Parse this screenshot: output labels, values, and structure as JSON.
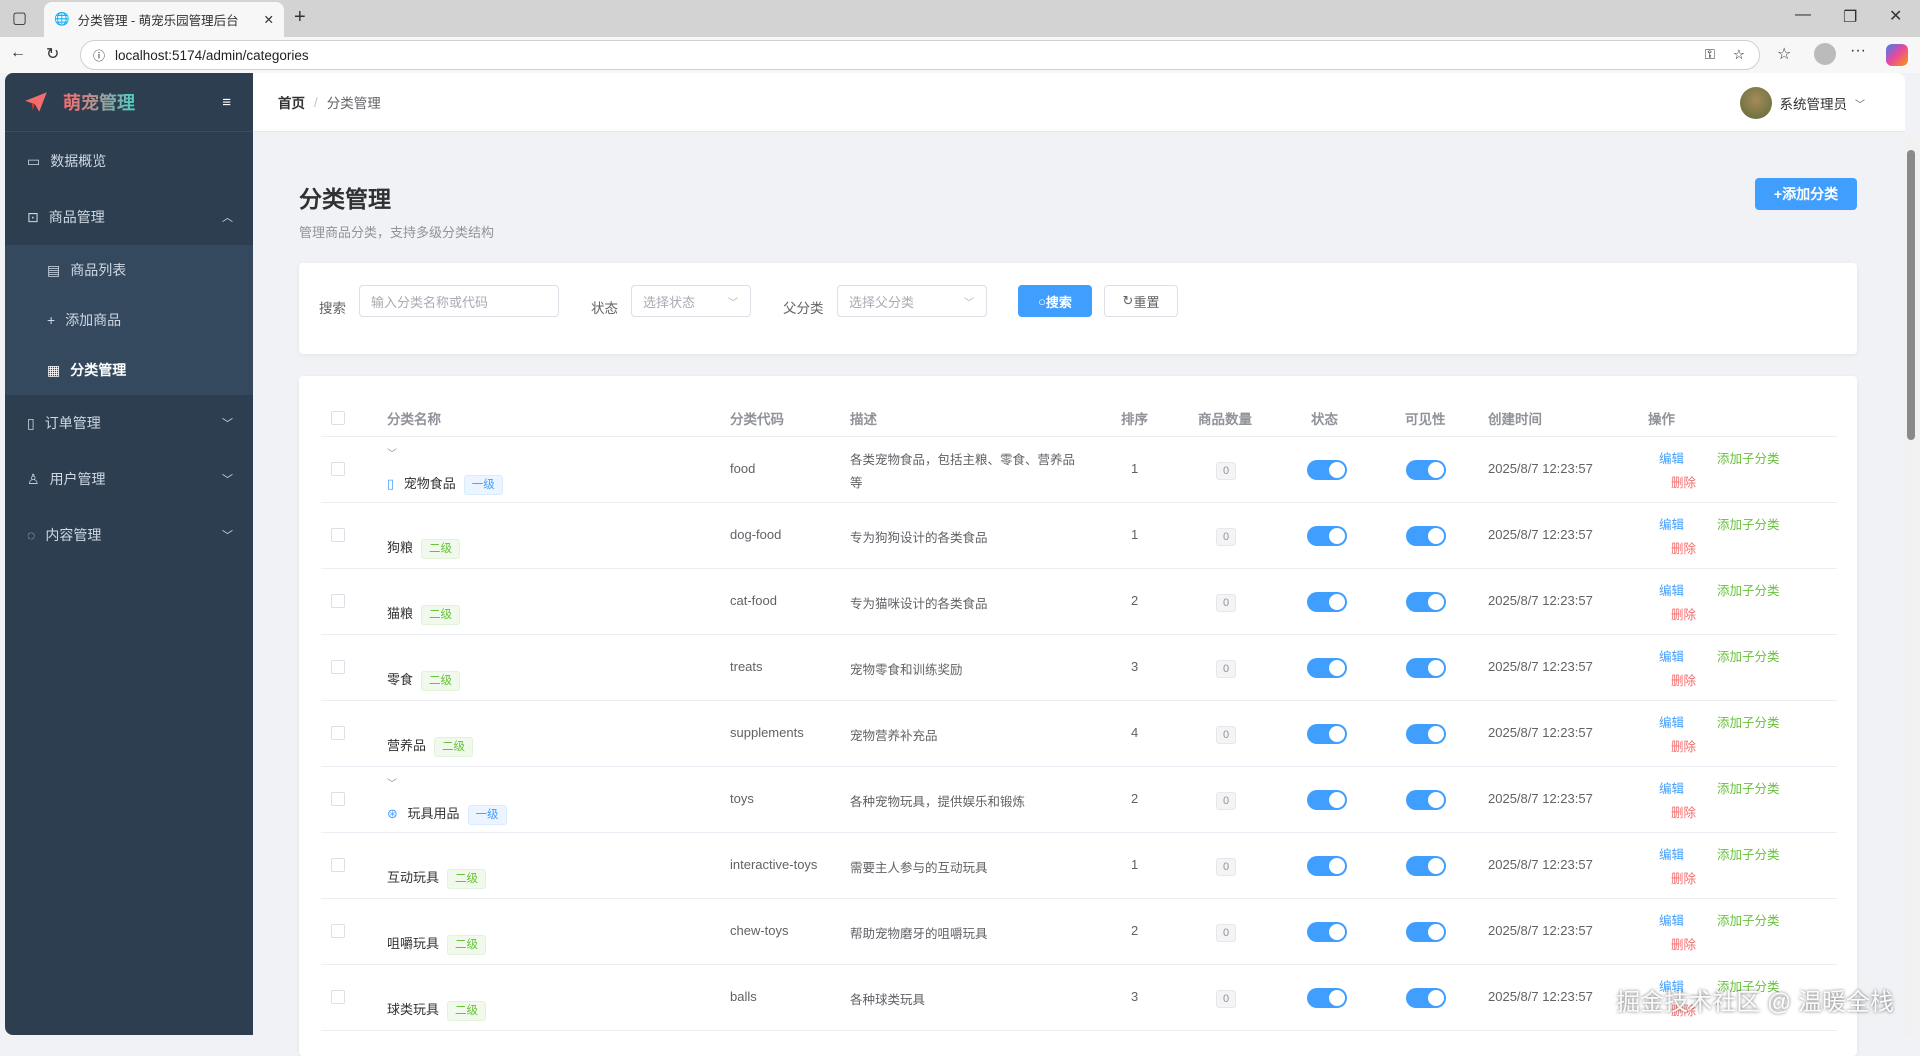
{
  "browser": {
    "tab_title": "分类管理 - 萌宠乐园管理后台",
    "url": "localhost:5174/admin/categories"
  },
  "sidebar": {
    "brand": "萌宠管理",
    "items": [
      {
        "label": "数据概览",
        "icon": "chart-icon"
      },
      {
        "label": "商品管理",
        "icon": "bag-icon",
        "expanded": true
      },
      {
        "label": "商品列表",
        "icon": "list-icon"
      },
      {
        "label": "添加商品",
        "icon": "plus-icon"
      },
      {
        "label": "分类管理",
        "icon": "grid-icon",
        "active": true
      },
      {
        "label": "订单管理",
        "icon": "document-icon"
      },
      {
        "label": "用户管理",
        "icon": "user-icon"
      },
      {
        "label": "内容管理",
        "icon": "chat-icon"
      }
    ]
  },
  "header": {
    "breadcrumb_home": "首页",
    "breadcrumb_sep": "/",
    "breadcrumb_current": "分类管理",
    "user": "系统管理员"
  },
  "page": {
    "title": "分类管理",
    "subtitle": "管理商品分类，支持多级分类结构",
    "add_button": "+添加分类"
  },
  "filter": {
    "search_label": "搜索",
    "search_placeholder": "输入分类名称或代码",
    "status_label": "状态",
    "status_placeholder": "选择状态",
    "parent_label": "父分类",
    "parent_placeholder": "选择父分类",
    "search_button": "搜索",
    "reset_button": "重置"
  },
  "table": {
    "columns": [
      "分类名称",
      "分类代码",
      "描述",
      "排序",
      "商品数量",
      "状态",
      "可见性",
      "创建时间",
      "操作"
    ],
    "actions": {
      "edit": "编辑",
      "add_child": "添加子分类",
      "delete": "删除"
    },
    "rows": [
      {
        "name": "宠物食品",
        "level": "一级",
        "code": "food",
        "desc": "各类宠物食品，包括主粮、零食、营养品",
        "desc2": "等",
        "sort": "1",
        "count": "0",
        "status": true,
        "visible": true,
        "created": "2025/8/7 12:23:57",
        "parent": true,
        "icon": "cup-icon"
      },
      {
        "name": "狗粮",
        "level": "二级",
        "code": "dog-food",
        "desc": "专为狗狗设计的各类食品",
        "sort": "1",
        "count": "0",
        "status": true,
        "visible": true,
        "created": "2025/8/7 12:23:57"
      },
      {
        "name": "猫粮",
        "level": "二级",
        "code": "cat-food",
        "desc": "专为猫咪设计的各类食品",
        "sort": "2",
        "count": "0",
        "status": true,
        "visible": true,
        "created": "2025/8/7 12:23:57"
      },
      {
        "name": "零食",
        "level": "二级",
        "code": "treats",
        "desc": "宠物零食和训练奖励",
        "sort": "3",
        "count": "0",
        "status": true,
        "visible": true,
        "created": "2025/8/7 12:23:57"
      },
      {
        "name": "营养品",
        "level": "二级",
        "code": "supplements",
        "desc": "宠物营养补充品",
        "sort": "4",
        "count": "0",
        "status": true,
        "visible": true,
        "created": "2025/8/7 12:23:57"
      },
      {
        "name": "玩具用品",
        "level": "一级",
        "code": "toys",
        "desc": "各种宠物玩具，提供娱乐和锻炼",
        "sort": "2",
        "count": "0",
        "status": true,
        "visible": true,
        "created": "2025/8/7 12:23:57",
        "parent": true,
        "icon": "ball-icon"
      },
      {
        "name": "互动玩具",
        "level": "二级",
        "code": "interactive-toys",
        "desc": "需要主人参与的互动玩具",
        "sort": "1",
        "count": "0",
        "status": true,
        "visible": true,
        "created": "2025/8/7 12:23:57"
      },
      {
        "name": "咀嚼玩具",
        "level": "二级",
        "code": "chew-toys",
        "desc": "帮助宠物磨牙的咀嚼玩具",
        "sort": "2",
        "count": "0",
        "status": true,
        "visible": true,
        "created": "2025/8/7 12:23:57"
      },
      {
        "name": "球类玩具",
        "level": "二级",
        "code": "balls",
        "desc": "各种球类玩具",
        "sort": "3",
        "count": "0",
        "status": true,
        "visible": true,
        "created": "2025/8/7 12:23:57"
      }
    ]
  },
  "watermark": "掘金技术社区 @ 温暖全栈",
  "colors": {
    "primary": "#409eff",
    "success": "#67c23a",
    "danger": "#f56c6c",
    "sidebar": "#2c3e50"
  }
}
